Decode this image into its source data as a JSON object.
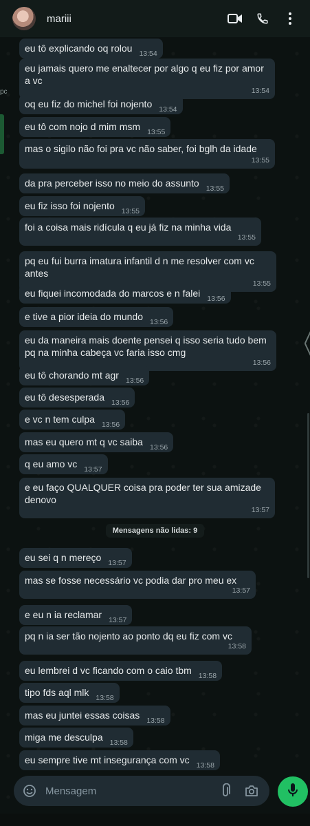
{
  "header": {
    "contact_name": "mariii",
    "icons": [
      "video-call-icon",
      "voice-call-icon",
      "more-options-icon"
    ]
  },
  "left_edge_text": "pc",
  "messages": [
    {
      "text": "eu tô explicando oq rolou",
      "time": "13:54"
    },
    {
      "text": "eu jamais quero me enaltecer por algo q eu fiz por amor a vc",
      "time": "13:54"
    },
    {
      "text": "oq eu fiz do michel foi nojento",
      "time": "13:54"
    },
    {
      "text": "eu tô com nojo d mim msm",
      "time": "13:55"
    },
    {
      "text": "mas o sigilo não foi pra vc não saber, foi bglh da idade",
      "time": "13:55"
    },
    {
      "text": "da pra perceber isso no meio do assunto",
      "time": "13:55"
    },
    {
      "text": "eu fiz isso foi nojento",
      "time": "13:55"
    },
    {
      "text": "foi a coisa mais ridícula q eu já fiz na minha vida",
      "time": "13:55"
    },
    {
      "text": "pq eu fui burra imatura infantil d n me resolver com vc antes",
      "time": "13:55"
    },
    {
      "text": "eu fiquei incomodada do marcos e n falei",
      "time": "13:56"
    },
    {
      "text": "e tive a pior ideia do mundo",
      "time": "13:56"
    },
    {
      "text": "eu da maneira mais doente pensei q isso seria tudo bem pq na minha cabeça vc faria isso cmg",
      "time": "13:56"
    },
    {
      "text": "eu tô chorando mt agr",
      "time": "13:56"
    },
    {
      "text": "eu tô desesperada",
      "time": "13:56"
    },
    {
      "text": "e vc n tem culpa",
      "time": "13:56"
    },
    {
      "text": "mas eu quero mt q vc saiba",
      "time": "13:56"
    },
    {
      "text": "q eu amo vc",
      "time": "13:57"
    },
    {
      "text": "e eu faço QUALQUER coisa pra poder ter sua amizade denovo",
      "time": "13:57"
    },
    {
      "text": "eu sei q n mereço",
      "time": "13:57"
    },
    {
      "text": "mas se fosse necessário vc podia dar pro meu ex",
      "time": "13:57"
    },
    {
      "text": "e eu n ia reclamar",
      "time": "13:57"
    },
    {
      "text": "pq n ia ser tão nojento ao ponto dq eu fiz com vc",
      "time": "13:58"
    },
    {
      "text": "eu lembrei d vc ficando com o caio tbm",
      "time": "13:58"
    },
    {
      "text": "tipo fds aql mlk",
      "time": "13:58"
    },
    {
      "text": "mas eu juntei essas coisas",
      "time": "13:58"
    },
    {
      "text": "miga me desculpa",
      "time": "13:58"
    },
    {
      "text": "eu sempre tive mt insegurança com vc",
      "time": "13:58"
    }
  ],
  "unread_divider": "Mensagens não lidas: 9",
  "composer": {
    "placeholder": "Mensagem",
    "icons": [
      "emoji-icon",
      "attach-icon",
      "camera-icon",
      "mic-icon"
    ],
    "accent_color": "#21c063"
  },
  "colors": {
    "bubble": "#202c33",
    "header": "#121b19",
    "background": "#0c1211"
  }
}
